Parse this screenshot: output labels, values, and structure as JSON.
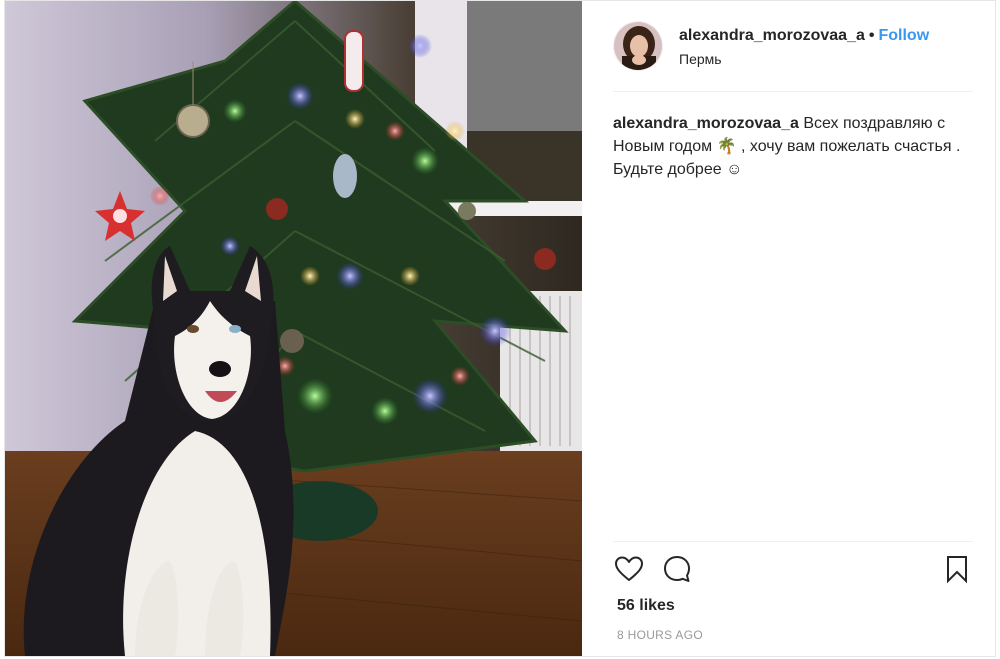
{
  "post": {
    "image_alt": "Husky dog sitting in front of a decorated Christmas tree",
    "author": {
      "username": "alexandra_morozovaa_a",
      "separator": "•",
      "follow_label": "Follow",
      "location": "Пермь"
    },
    "caption": {
      "username": "alexandra_morozovaa_a",
      "text": " Всех поздравляю с Новым годом 🌴 , хочу вам пожелать счастья . Будьте добрее ☺"
    },
    "actions": {
      "like_icon": "heart-icon",
      "comment_icon": "comment-icon",
      "save_icon": "bookmark-icon"
    },
    "likes_label": "56 likes",
    "timestamp": "8 HOURS AGO"
  },
  "colors": {
    "link": "#3897f0",
    "text": "#262626",
    "muted": "#999999",
    "border": "#efefef"
  }
}
